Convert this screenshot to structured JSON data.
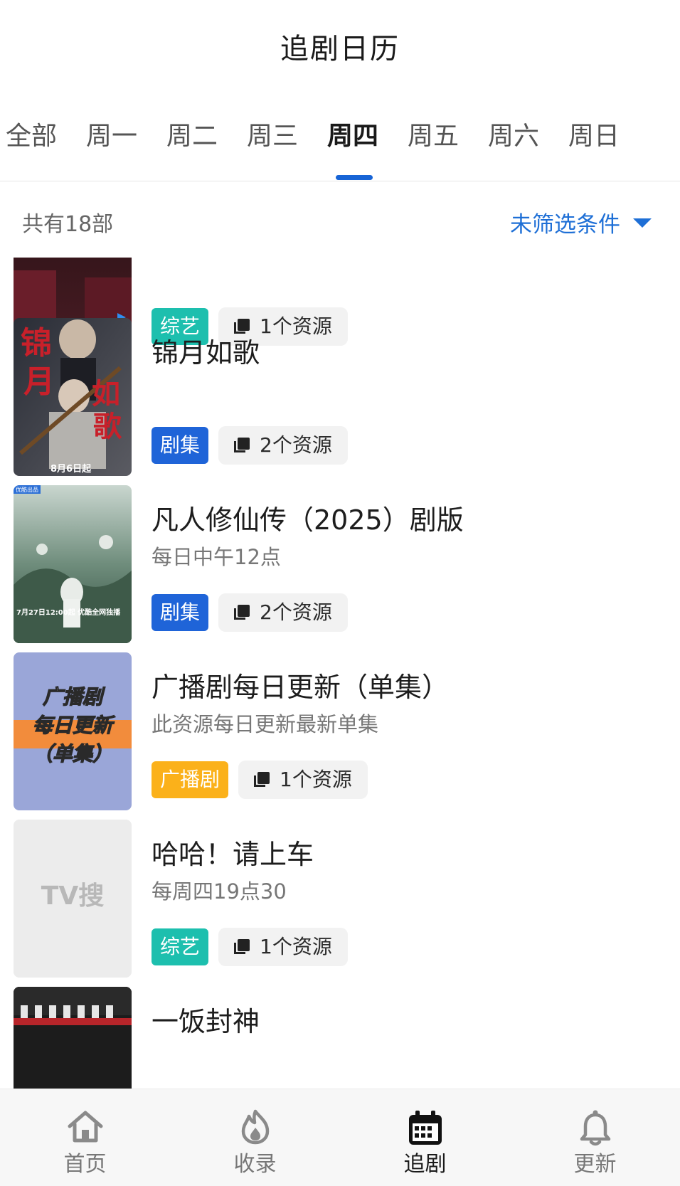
{
  "header": {
    "title": "追剧日历"
  },
  "tabs": [
    {
      "label": "全部",
      "active": false
    },
    {
      "label": "周一",
      "active": false
    },
    {
      "label": "周二",
      "active": false
    },
    {
      "label": "周三",
      "active": false
    },
    {
      "label": "周四",
      "active": true
    },
    {
      "label": "周五",
      "active": false
    },
    {
      "label": "周六",
      "active": false
    },
    {
      "label": "周日",
      "active": false
    }
  ],
  "summary": {
    "count_text": "共有18部",
    "filter_label": "未筛选条件"
  },
  "items": [
    {
      "title": "",
      "subtitle": "",
      "tag": "综艺",
      "tag_color": "#1dbfae",
      "resources": "1个资源"
    },
    {
      "title": "锦月如歌",
      "subtitle": "",
      "tag": "剧集",
      "tag_color": "#1f64d8",
      "resources": "2个资源"
    },
    {
      "title": "凡人修仙传（2025）剧版",
      "subtitle": "每日中午12点",
      "tag": "剧集",
      "tag_color": "#1f64d8",
      "resources": "2个资源"
    },
    {
      "title": "广播剧每日更新（单集）",
      "subtitle": "此资源每日更新最新单集",
      "tag": "广播剧",
      "tag_color": "#fbb11a",
      "resources": "1个资源"
    },
    {
      "title": "哈哈！请上车",
      "subtitle": "每周四19点30",
      "tag": "综艺",
      "tag_color": "#1dbfae",
      "resources": "1个资源"
    },
    {
      "title": "一饭封神",
      "subtitle": "",
      "tag": "",
      "tag_color": "",
      "resources": ""
    }
  ],
  "posters": {
    "p1": {
      "date_text": "8月6日起"
    },
    "p2": {
      "badge": "优酷出品",
      "date_text": "7月27日12:00起 优酷全网独播"
    },
    "p3": {
      "line1": "广播剧",
      "line2": "每日更新",
      "line3": "（单集）"
    },
    "p4": {
      "placeholder": "TV搜"
    }
  },
  "nav": [
    {
      "label": "首页",
      "icon": "home-icon",
      "active": false
    },
    {
      "label": "收录",
      "icon": "flame-icon",
      "active": false
    },
    {
      "label": "追剧",
      "icon": "calendar-icon",
      "active": true
    },
    {
      "label": "更新",
      "icon": "bell-icon",
      "active": false
    }
  ]
}
